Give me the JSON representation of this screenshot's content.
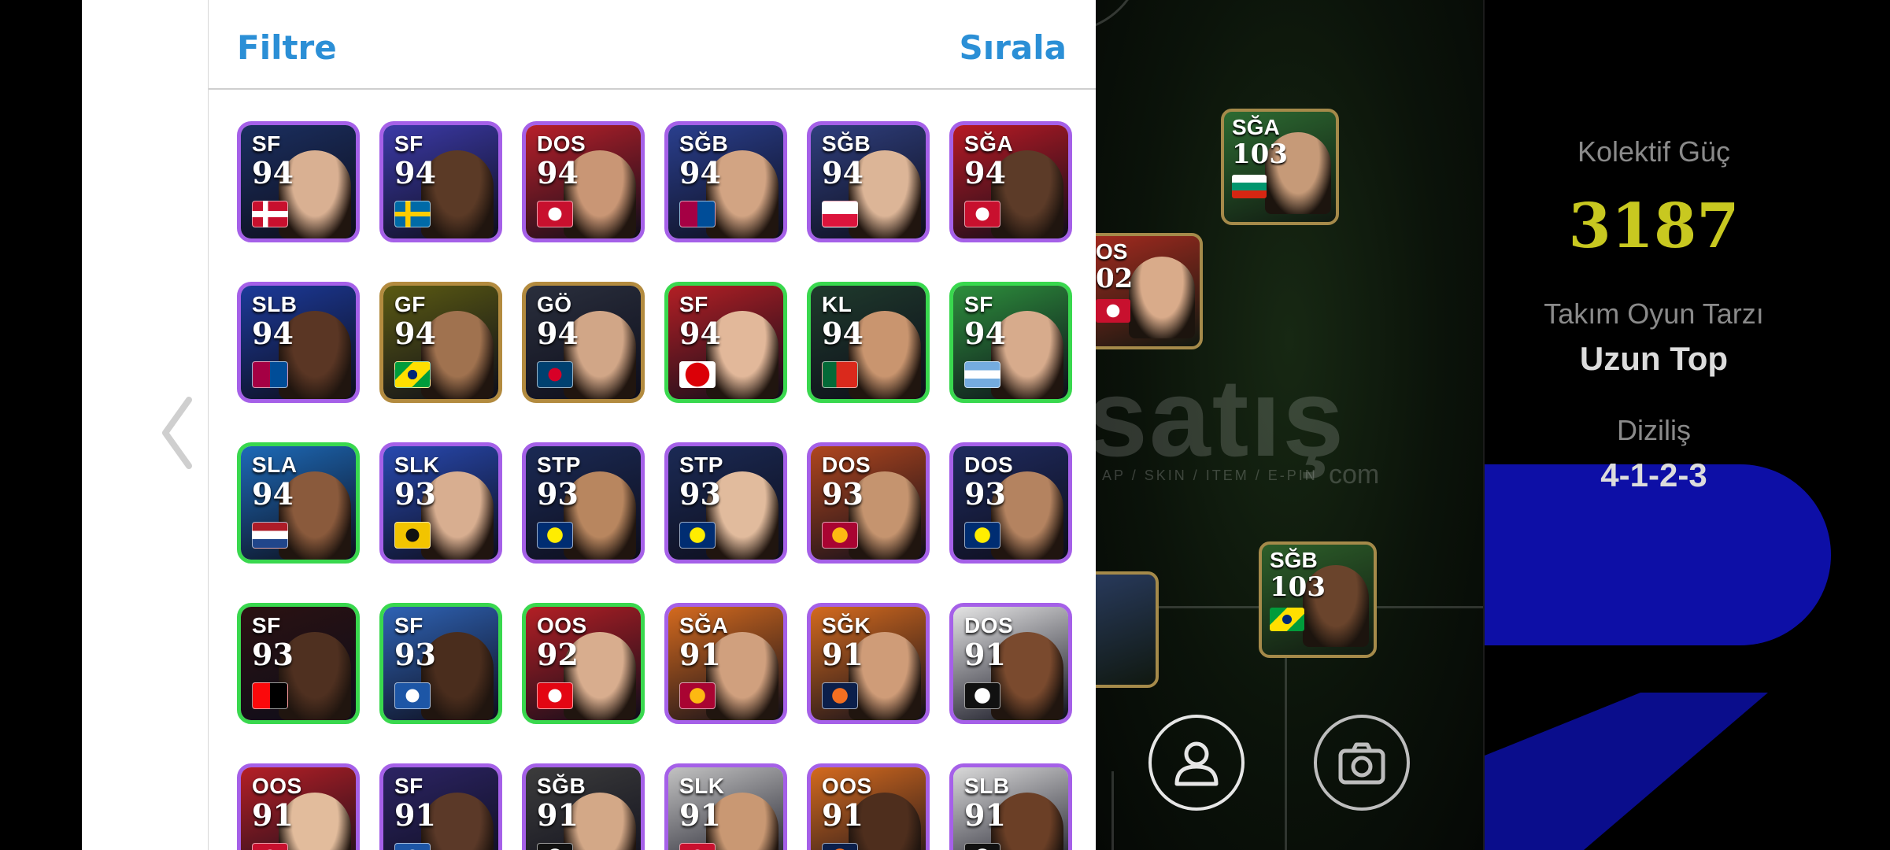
{
  "header": {
    "filter_label": "Filtre",
    "sort_label": "Sırala"
  },
  "players": [
    {
      "pos": "SF",
      "rating": "94",
      "frame": "purple",
      "bg": "#1b2f60",
      "skin": "#d9b092",
      "flag": "norway"
    },
    {
      "pos": "SF",
      "rating": "94",
      "frame": "purple",
      "bg": "#3c3aa8",
      "skin": "#5b3a26",
      "flag": "sweden"
    },
    {
      "pos": "DOS",
      "rating": "94",
      "frame": "purple",
      "bg": "#b8202a",
      "skin": "#c99675",
      "flag": "club-red"
    },
    {
      "pos": "SĞB",
      "rating": "94",
      "frame": "purple",
      "bg": "#2a3f8e",
      "skin": "#d2a483",
      "flag": "barca"
    },
    {
      "pos": "SĞB",
      "rating": "94",
      "frame": "purple",
      "bg": "#2f3f7e",
      "skin": "#dcb597",
      "flag": "poland"
    },
    {
      "pos": "SĞA",
      "rating": "94",
      "frame": "purple",
      "bg": "#b81a24",
      "skin": "#5c3b28",
      "flag": "club-red"
    },
    {
      "pos": "SLB",
      "rating": "94",
      "frame": "purple",
      "bg": "#1c3a9a",
      "skin": "#5a3624",
      "flag": "barca"
    },
    {
      "pos": "GF",
      "rating": "94",
      "frame": "gold",
      "bg": "#5b5a12",
      "skin": "#a0724f",
      "flag": "brazil"
    },
    {
      "pos": "GÖ",
      "rating": "94",
      "frame": "gold",
      "bg": "#2a2f3d",
      "skin": "#d1a687",
      "flag": "psg"
    },
    {
      "pos": "SF",
      "rating": "94",
      "frame": "green",
      "bg": "#b31f25",
      "skin": "#e2b89a",
      "flag": "arsenal"
    },
    {
      "pos": "KL",
      "rating": "94",
      "frame": "green",
      "bg": "#1f3a2c",
      "skin": "#c9956f",
      "flag": "portugal"
    },
    {
      "pos": "SF",
      "rating": "94",
      "frame": "green",
      "bg": "#2d8f3c",
      "skin": "#d7ab8c",
      "flag": "argentina"
    },
    {
      "pos": "SLA",
      "rating": "94",
      "frame": "green",
      "bg": "#1d6ab8",
      "skin": "#8a5a3c",
      "flag": "netherlands"
    },
    {
      "pos": "SLK",
      "rating": "93",
      "frame": "purple",
      "bg": "#2849b0",
      "skin": "#d8ae90",
      "flag": "club-yellow"
    },
    {
      "pos": "STP",
      "rating": "93",
      "frame": "purple",
      "bg": "#1b2a55",
      "skin": "#b8865f",
      "flag": "fener"
    },
    {
      "pos": "STP",
      "rating": "93",
      "frame": "purple",
      "bg": "#1b2a55",
      "skin": "#e1bb9d",
      "flag": "fener"
    },
    {
      "pos": "DOS",
      "rating": "93",
      "frame": "purple",
      "bg": "#b0461e",
      "skin": "#c5946f",
      "flag": "gala"
    },
    {
      "pos": "DOS",
      "rating": "93",
      "frame": "purple",
      "bg": "#1f2b5f",
      "skin": "#b48360",
      "flag": "fener"
    },
    {
      "pos": "SF",
      "rating": "93",
      "frame": "green",
      "bg": "#2b1212",
      "skin": "#4f3020",
      "flag": "milan"
    },
    {
      "pos": "SF",
      "rating": "93",
      "frame": "green",
      "bg": "#2f63b5",
      "skin": "#4a2d1d",
      "flag": "club-blue"
    },
    {
      "pos": "OOS",
      "rating": "92",
      "frame": "green",
      "bg": "#b31f25",
      "skin": "#d8ad8e",
      "flag": "benfica"
    },
    {
      "pos": "SĞA",
      "rating": "91",
      "frame": "purple",
      "bg": "#d46a1e",
      "skin": "#d0a07e",
      "flag": "gala"
    },
    {
      "pos": "SĞK",
      "rating": "91",
      "frame": "purple",
      "bg": "#d46a1e",
      "skin": "#cf9c78",
      "flag": "basak"
    },
    {
      "pos": "DOS",
      "rating": "91",
      "frame": "purple",
      "bg": "#e4e4e4",
      "skin": "#7a4a2e",
      "flag": "bjk"
    },
    {
      "pos": "OOS",
      "rating": "91",
      "frame": "purple",
      "bg": "#b51f26",
      "skin": "#e2bc9c",
      "flag": "club-red"
    },
    {
      "pos": "SF",
      "rating": "91",
      "frame": "purple",
      "bg": "#2c2464",
      "skin": "#5b3928",
      "flag": "club-blue"
    },
    {
      "pos": "SĞB",
      "rating": "91",
      "frame": "purple",
      "bg": "#3c3c3c",
      "skin": "#d3a887",
      "flag": "bjk"
    },
    {
      "pos": "SLK",
      "rating": "91",
      "frame": "purple",
      "bg": "#c2c2c2",
      "skin": "#c99873",
      "flag": "club-red"
    },
    {
      "pos": "OOS",
      "rating": "91",
      "frame": "purple",
      "bg": "#d46a1e",
      "skin": "#4e2e1d",
      "flag": "basak"
    },
    {
      "pos": "SLB",
      "rating": "91",
      "frame": "purple",
      "bg": "#d9d9d9",
      "skin": "#6b3f26",
      "flag": "bjk"
    }
  ],
  "field_players": [
    {
      "pos": "SĞA",
      "rating": "103",
      "flag": "bulgaria",
      "bg": "#2d6b32",
      "skin": "#c69a78"
    },
    {
      "pos": "OS",
      "rating": "02",
      "flag": "club-red",
      "bg": "#a42a1f",
      "skin": "#d9ab8a"
    },
    {
      "pos": "SĞB",
      "rating": "103",
      "flag": "brazil",
      "bg": "#2d5f2a",
      "skin": "#6a442c"
    }
  ],
  "watermark": {
    "main": "satış",
    "sub": "AP / SKIN / ITEM / E-PIN",
    "domain": "com"
  },
  "info": {
    "kolektif_label": "Kolektif Güç",
    "kolektif_value": "3187",
    "style_label": "Takım Oyun Tarzı",
    "style_value": "Uzun Top",
    "formation_label": "Diziliş",
    "formation_value": "4-1-2-3"
  },
  "colors": {
    "accent": "#2b8fd6",
    "kolektif": "#c8c820",
    "purple_frame": "#a560e8",
    "green_frame": "#39d84e",
    "gold_frame": "#b38b3f"
  }
}
